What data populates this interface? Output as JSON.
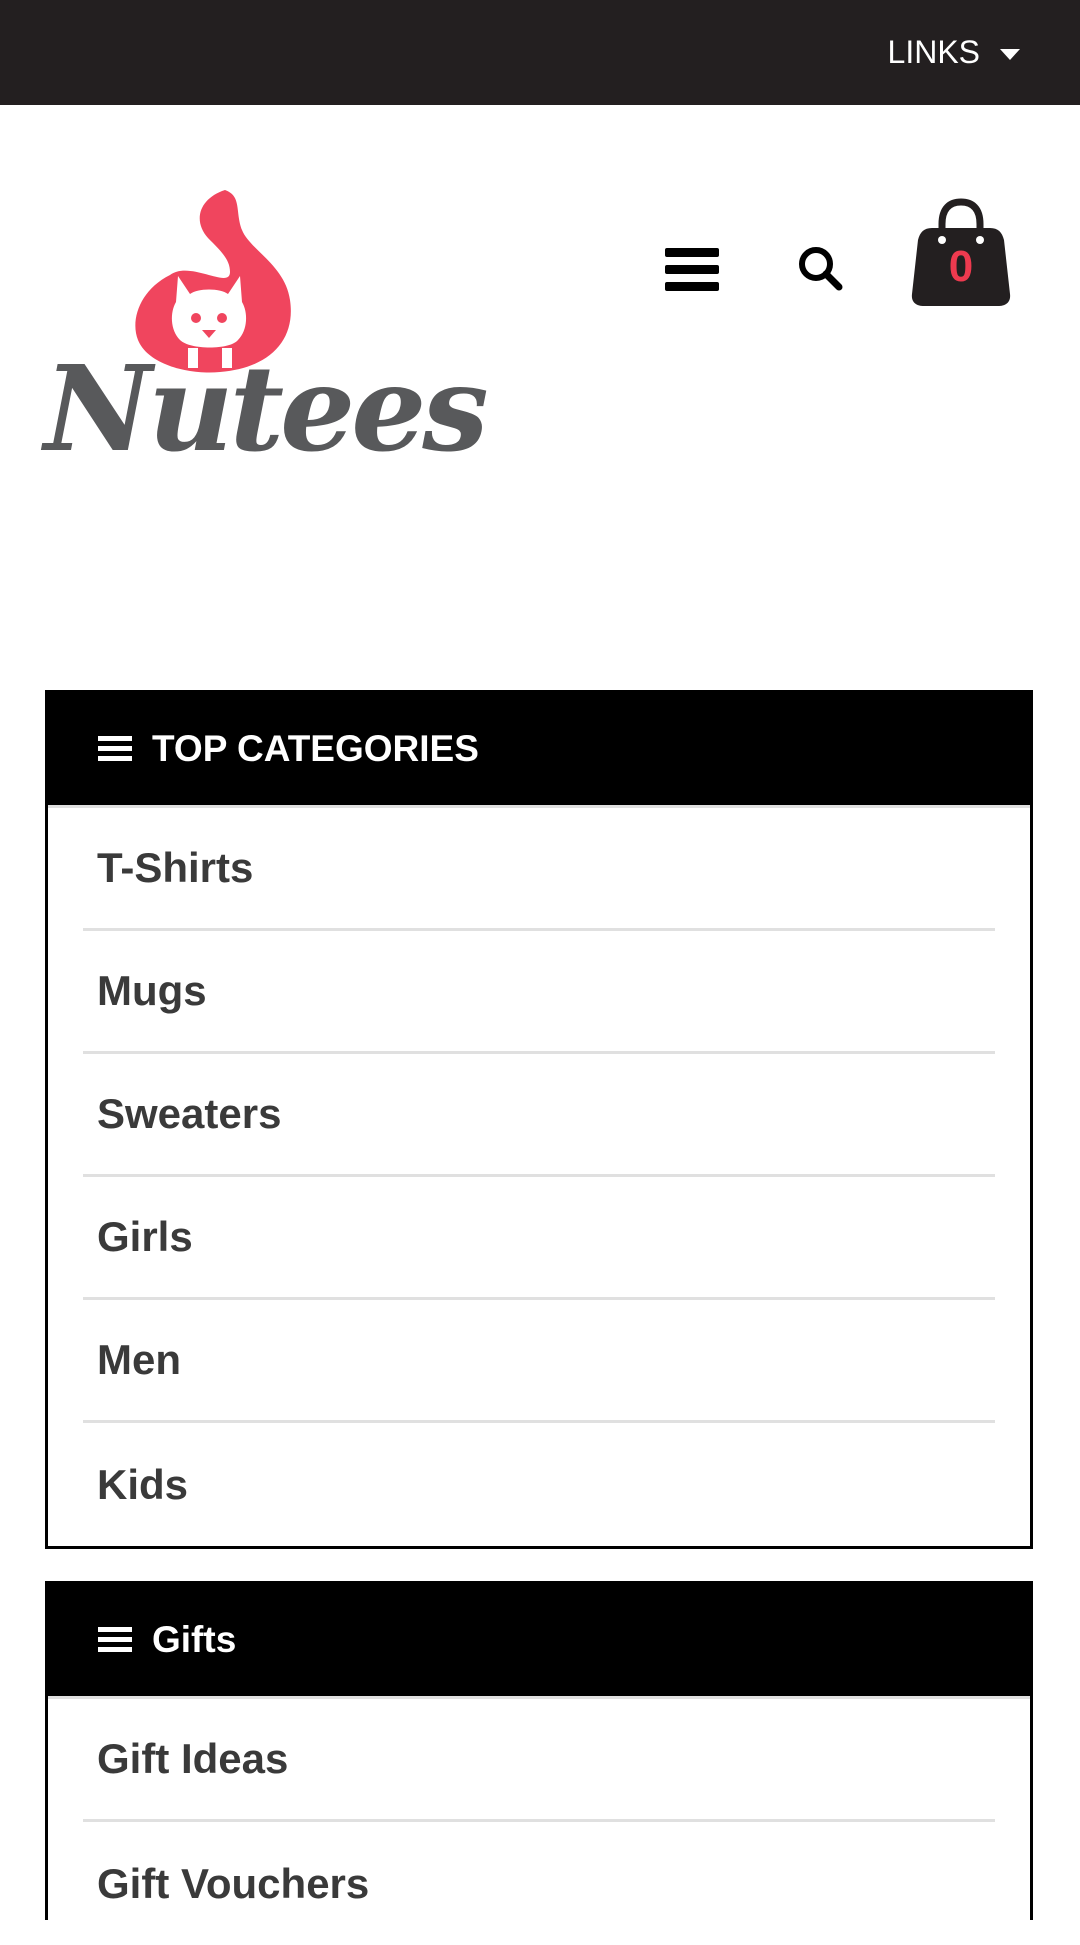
{
  "topbar": {
    "links_label": "LINKS",
    "links_icon": "caret-down-icon"
  },
  "logo": {
    "text": "Nutees",
    "mark_color": "#f0455e",
    "text_color": "#58595b"
  },
  "header": {
    "menu_icon": "hamburger-menu-icon",
    "search_icon": "search-icon",
    "cart_icon": "shopping-bag-icon",
    "cart_count": "0",
    "cart_count_color": "#ee3a4f"
  },
  "top_categories": {
    "title": "TOP CATEGORIES",
    "icon": "list-icon",
    "items": [
      {
        "label": "T-Shirts"
      },
      {
        "label": "Mugs"
      },
      {
        "label": "Sweaters"
      },
      {
        "label": "Girls"
      },
      {
        "label": "Men"
      },
      {
        "label": "Kids"
      }
    ]
  },
  "gifts": {
    "title": "Gifts",
    "icon": "list-icon",
    "items": [
      {
        "label": "Gift Ideas"
      },
      {
        "label": "Gift Vouchers"
      }
    ]
  },
  "colors": {
    "topbar_bg": "#231f20",
    "panel_head_bg": "#000000",
    "divider": "#e0e0e0"
  }
}
